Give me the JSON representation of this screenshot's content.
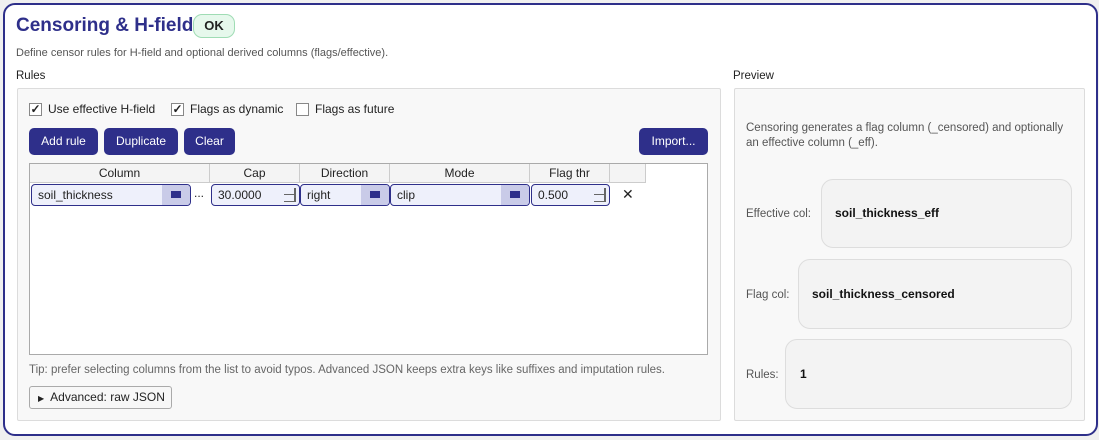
{
  "header": {
    "title": "Censoring & H-field",
    "status": "OK",
    "subtitle": "Define censor rules for H-field and optional derived columns (flags/effective)."
  },
  "rules": {
    "label": "Rules",
    "options": [
      {
        "label": "Use effective H-field",
        "checked": true
      },
      {
        "label": "Flags as dynamic",
        "checked": true
      },
      {
        "label": "Flags as future",
        "checked": false
      }
    ],
    "buttons": {
      "add": "Add rule",
      "duplicate": "Duplicate",
      "clear": "Clear",
      "import": "Import..."
    },
    "table": {
      "headers": [
        "Column",
        "Cap",
        "Direction",
        "Mode",
        "Flag thr"
      ],
      "rows": [
        {
          "column": "soil_thickness",
          "more": "...",
          "cap": "30.0000",
          "direction": "right",
          "mode": "clip",
          "flag_thr": "0.500",
          "remove": "✕"
        }
      ]
    },
    "tip": "Tip: prefer selecting columns from the list to avoid typos. Advanced JSON keeps extra keys like suffixes and imputation rules.",
    "advanced": "Advanced: raw JSON"
  },
  "preview": {
    "label": "Preview",
    "description": "Censoring generates a flag column (_censored) and optionally an effective column (_eff).",
    "effective_label": "Effective col:",
    "effective_value": "soil_thickness_eff",
    "flag_label": "Flag col:",
    "flag_value": "soil_thickness_censored",
    "rules_label": "Rules:",
    "rules_value": "1"
  },
  "colors": {
    "accent": "#2e2f8a",
    "ok_bg": "#e6f8ec"
  }
}
